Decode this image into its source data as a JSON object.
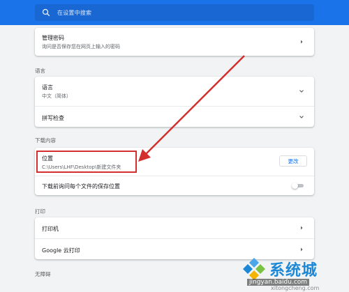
{
  "search": {
    "placeholder": "在设置中搜索",
    "icon": "search-icon"
  },
  "passwords": {
    "title": "管理密码",
    "subtitle": "询问是否保存您在网页上输入的密码"
  },
  "languages": {
    "section": "语言",
    "rows": [
      {
        "title": "语言",
        "subtitle": "中文（简体）"
      },
      {
        "title": "拼写检查"
      }
    ]
  },
  "downloads": {
    "section": "下载内容",
    "location_title": "位置",
    "location_path": "C:\\Users\\LHF\\Desktop\\新建文件夹",
    "change_button": "更改",
    "ask_label": "下载前询问每个文件的保存位置",
    "ask_enabled": false
  },
  "printing": {
    "section": "打印",
    "rows": [
      {
        "title": "打印机"
      },
      {
        "title": "Google 云打印"
      }
    ]
  },
  "accessibility": {
    "section": "无障碍"
  },
  "colors": {
    "accent": "#1a73e8",
    "highlight": "#d32f2f"
  },
  "watermark": {
    "brand": "系统城",
    "url": "jingyan.baidu.com",
    "url2": "xitongcheng.com"
  }
}
